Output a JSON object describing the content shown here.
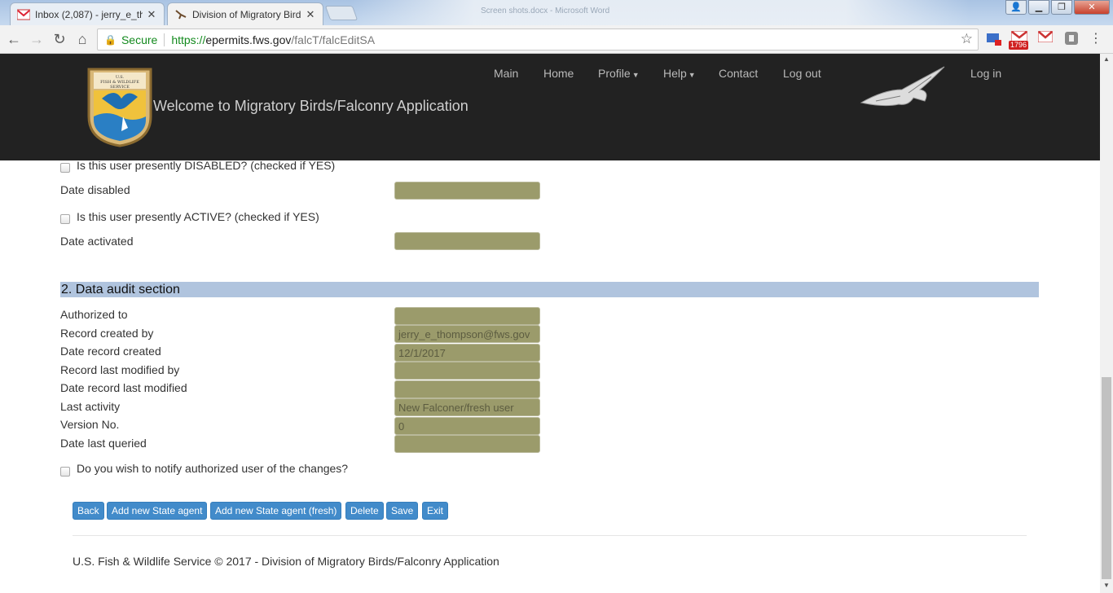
{
  "browser": {
    "tabs": [
      {
        "label": "Inbox (2,087) - jerry_e_th",
        "active": false
      },
      {
        "label": "Division of Migratory Bird",
        "active": true
      }
    ],
    "window_title_blur": "Screen shots.docx - Microsoft Word",
    "url_secure_label": "Secure",
    "url_scheme": "https://",
    "url_host": "epermits.fws.gov",
    "url_path": "/falcT/falcEditSA",
    "extension_badge": "1796"
  },
  "header": {
    "welcome": "Welcome to Migratory Birds/Falconry Application",
    "seal_text_top": "U.S. FISH & WILDLIFE SERVICE",
    "nav": {
      "main": "Main",
      "home": "Home",
      "profile": "Profile",
      "help": "Help",
      "contact": "Contact",
      "logout": "Log out",
      "login": "Log in"
    }
  },
  "status": {
    "disabled_question": "Is this user presently DISABLED? (checked if YES)",
    "date_disabled_label": "Date disabled",
    "date_disabled_value": "",
    "active_question": "Is this user presently ACTIVE? (checked if YES)",
    "date_activated_label": "Date activated",
    "date_activated_value": ""
  },
  "audit": {
    "title": "2. Data audit section",
    "fields": [
      {
        "label": "Authorized to",
        "value": ""
      },
      {
        "label": "Record created by",
        "value": "jerry_e_thompson@fws.gov"
      },
      {
        "label": "Date record created",
        "value": "12/1/2017"
      },
      {
        "label": "Record last modified by",
        "value": ""
      },
      {
        "label": "Date record last modified",
        "value": ""
      },
      {
        "label": "Last activity",
        "value": "New Falconer/fresh user"
      },
      {
        "label": "Version No.",
        "value": "0"
      },
      {
        "label": "Date last queried",
        "value": ""
      }
    ],
    "notify_question": "Do you wish to notify authorized user of the changes?"
  },
  "buttons": {
    "back": "Back",
    "add_state_agent": "Add new State agent",
    "add_state_agent_fresh": "Add new State agent (fresh)",
    "delete": "Delete",
    "save": "Save",
    "exit": "Exit"
  },
  "footer": "U.S. Fish & Wildlife Service © 2017 - Division of Migratory Birds/Falconry Application",
  "colors": {
    "header_bg": "#222222",
    "field_bg": "#9b9b6b",
    "section_bar": "#b0c4de",
    "button": "#428bca"
  }
}
